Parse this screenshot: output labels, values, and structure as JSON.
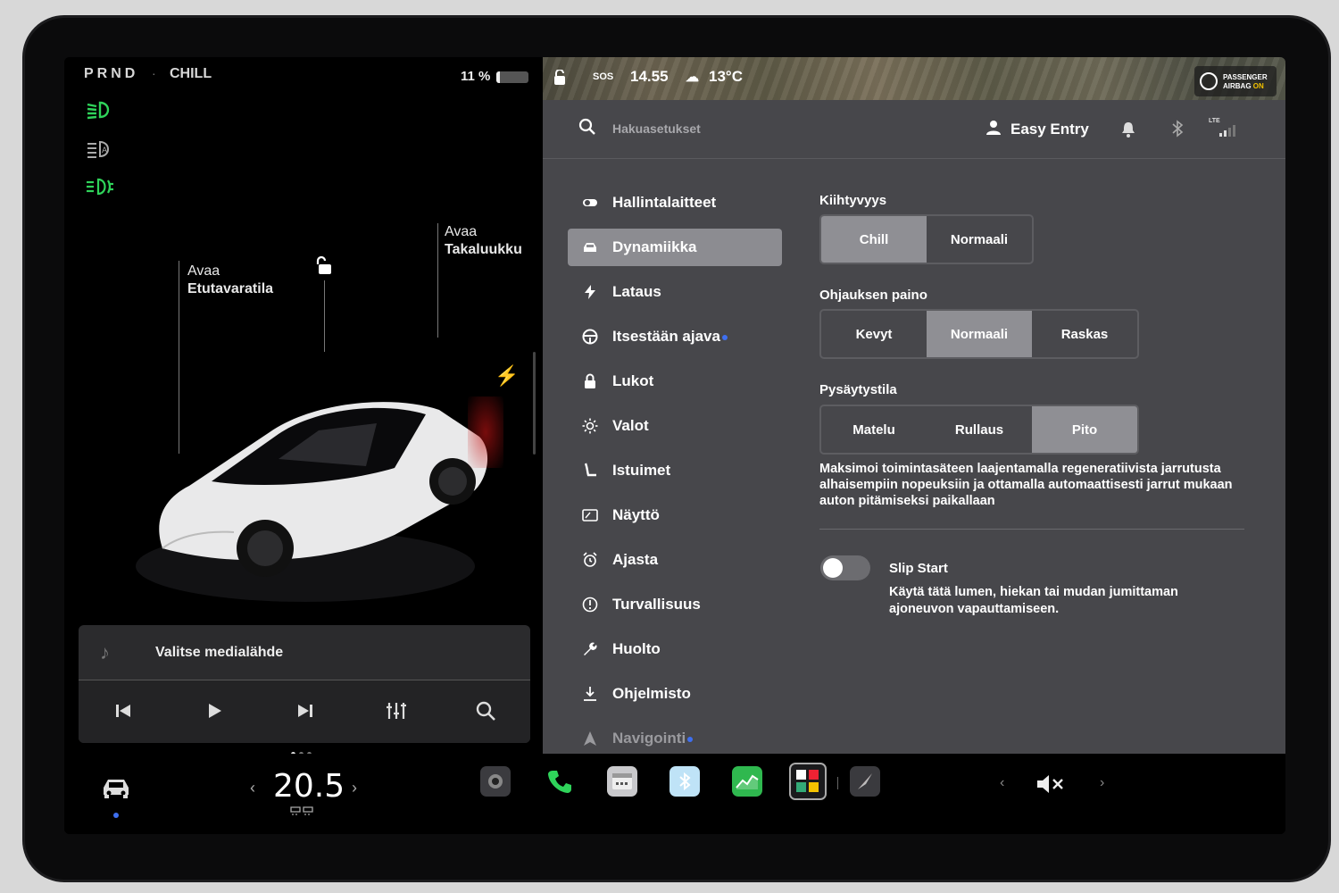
{
  "status_bar": {
    "gear": "PRND",
    "separator": "·",
    "drive_mode": "CHILL",
    "battery_pct": "11 %",
    "battery_level": 0.11
  },
  "car_view": {
    "frunk": {
      "line1": "Avaa",
      "line2": "Etutavaratila"
    },
    "trunk": {
      "line1": "Avaa",
      "line2": "Takaluukku"
    }
  },
  "media": {
    "source_label": "Valitse medialähde"
  },
  "map_status": {
    "sos": "SOS",
    "time": "14.55",
    "temperature": "13°C",
    "airbag_line1": "PASSENGER",
    "airbag_line2_a": "AIRBAG",
    "airbag_line2_b": "ON"
  },
  "topbar": {
    "search_placeholder": "Hakuasetukset",
    "profile": "Easy Entry",
    "network": "LTE"
  },
  "menu": [
    {
      "label": "Hallintalaitteet",
      "icon": "toggle-icon"
    },
    {
      "label": "Dynamiikka",
      "icon": "car-icon",
      "active": true
    },
    {
      "label": "Lataus",
      "icon": "bolt-icon"
    },
    {
      "label": "Itsestään ajava",
      "icon": "steering-wheel-icon",
      "dot": true
    },
    {
      "label": "Lukot",
      "icon": "lock-icon"
    },
    {
      "label": "Valot",
      "icon": "sun-icon"
    },
    {
      "label": "Istuimet",
      "icon": "seat-icon"
    },
    {
      "label": "Näyttö",
      "icon": "display-icon"
    },
    {
      "label": "Ajasta",
      "icon": "alarm-clock-icon"
    },
    {
      "label": "Turvallisuus",
      "icon": "alert-icon"
    },
    {
      "label": "Huolto",
      "icon": "wrench-icon"
    },
    {
      "label": "Ohjelmisto",
      "icon": "download-icon"
    },
    {
      "label": "Navigointi",
      "icon": "navigation-icon",
      "dot": true
    }
  ],
  "settings": {
    "acceleration": {
      "title": "Kiihtyvyys",
      "options": [
        "Chill",
        "Normaali"
      ],
      "selected": "Chill"
    },
    "steering": {
      "title": "Ohjauksen paino",
      "options": [
        "Kevyt",
        "Normaali",
        "Raskas"
      ],
      "selected": "Normaali"
    },
    "stopping": {
      "title": "Pysäytystila",
      "options": [
        "Matelu",
        "Rullaus",
        "Pito"
      ],
      "selected": "Pito"
    },
    "stopping_desc": "Maksimoi toimintasäteen laajentamalla regeneratiivista jarrutusta alhaisempiin nopeuksiin ja ottamalla automaattisesti jarrut mukaan auton pitämiseksi paikallaan",
    "slip_start": {
      "title": "Slip Start",
      "desc": "Käytä tätä lumen, hiekan tai mudan jumittaman ajoneuvon vapauttamiseen.",
      "enabled": false
    }
  },
  "dock": {
    "temperature": "20.5",
    "temp_left": "‹",
    "temp_right": "›",
    "vol_left": "‹",
    "vol_right": "›"
  },
  "colors": {
    "accent_blue": "#3e6ff0",
    "indicator_green": "#2fd35a",
    "panel_bg": "#47474b",
    "selected_bg": "#8f8f94"
  }
}
